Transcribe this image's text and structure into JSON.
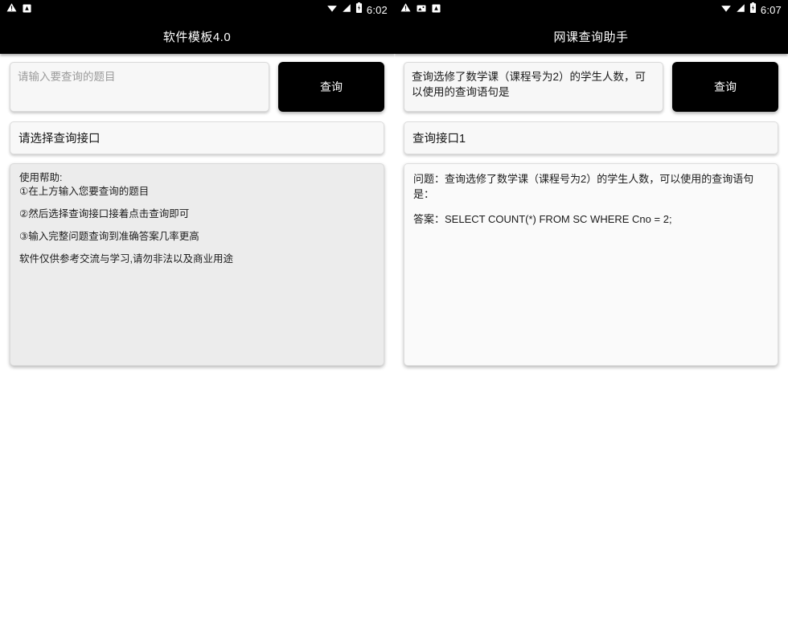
{
  "left": {
    "statusbar": {
      "icons": [
        "warning-triangle-icon",
        "app-badge-icon"
      ],
      "wifi_icon": "wifi-icon",
      "signal_icon": "signal-bars-icon",
      "battery_icon": "battery-charging-icon",
      "time": "6:02"
    },
    "title": "软件模板4.0",
    "input": {
      "value": "",
      "placeholder": "请输入要查询的题目"
    },
    "query_button": "查询",
    "select": {
      "value": "请选择查询接口",
      "is_placeholder": true
    },
    "help": {
      "lines": [
        "使用帮助:",
        "①在上方输入您要查询的题目",
        "②然后选择查询接口接着点击查询即可",
        "③输入完整问题查询到准确答案几率更高",
        "软件仅供参考交流与学习,请勿非法以及商业用途"
      ]
    }
  },
  "right": {
    "statusbar": {
      "icons": [
        "warning-triangle-icon",
        "screenshot-icon",
        "app-badge-icon"
      ],
      "wifi_icon": "wifi-icon",
      "signal_icon": "signal-bars-icon",
      "battery_icon": "battery-charging-icon",
      "time": "6:07"
    },
    "title": "网课查询助手",
    "input": {
      "value": "查询选修了数学课（课程号为2）的学生人数，可以使用的查询语句是",
      "placeholder": "请输入要查询的题目"
    },
    "query_button": "查询",
    "select": {
      "value": "查询接口1",
      "is_placeholder": false
    },
    "result": {
      "question_line": "问题：查询选修了数学课（课程号为2）的学生人数，可以使用的查询语句是：",
      "answer_line": "答案：SELECT COUNT(*) FROM SC WHERE Cno = 2;"
    }
  },
  "colors": {
    "bar_background": "#000000",
    "bar_text": "#ffffff",
    "page_background": "#ffffff",
    "help_panel": "#ececec",
    "result_panel": "#fafafa",
    "button": "#000000",
    "placeholder_text": "#9b9b9b"
  }
}
